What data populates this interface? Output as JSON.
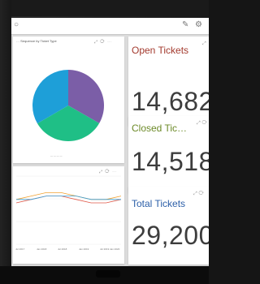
{
  "widgets": {
    "pie": {
      "title": "… Sequence by Ticket Type",
      "tools": "⤢ ⟳ ⋯",
      "legend": "— — — —"
    },
    "line": {
      "tools": "⤢ ⟳ ⋯"
    },
    "open": {
      "title": "Open Tickets",
      "tools": "⤢",
      "value": "14,682"
    },
    "closed": {
      "title": "Closed Tic…",
      "tools": "⤢ ⟳",
      "value": "14,518"
    },
    "total": {
      "title": "Total Tickets",
      "tools": "⤢ ⟳",
      "value": "29,200"
    }
  },
  "chart_data": [
    {
      "type": "pie",
      "values": [
        33.3,
        33.3,
        33.4
      ],
      "colors": [
        "#7b5ea7",
        "#1fbf86",
        "#1e9fd8"
      ]
    },
    {
      "type": "line",
      "x": [
        "Jul 2017",
        "Jan 2018",
        "Jul 2018",
        "Jan 2019",
        "Jul 2019",
        "Jan 2020"
      ],
      "series": [
        {
          "values": [
            6,
            7,
            8,
            8,
            7,
            6,
            6,
            7
          ],
          "color": "#f0a030"
        },
        {
          "values": [
            5,
            6,
            7,
            7,
            6,
            5,
            5,
            6
          ],
          "color": "#e05a4a"
        },
        {
          "values": [
            6,
            6,
            7,
            7,
            7,
            6,
            6,
            6
          ],
          "color": "#3aa0d8"
        }
      ],
      "ylim": [
        0,
        20
      ]
    }
  ]
}
